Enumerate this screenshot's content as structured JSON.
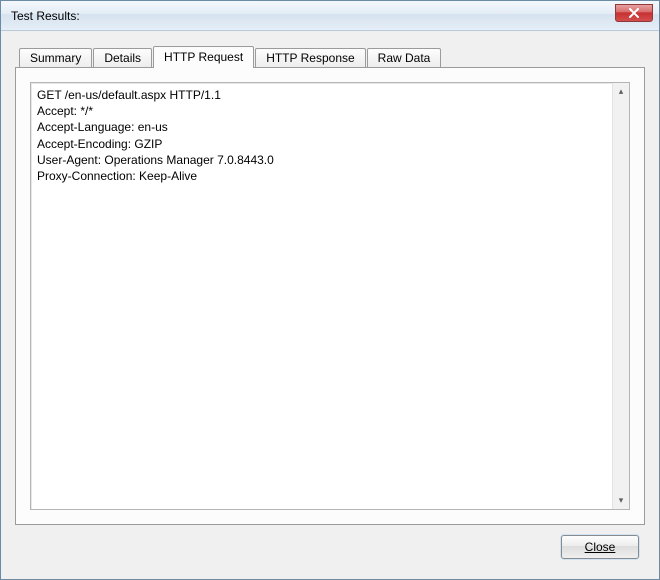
{
  "window": {
    "title": "Test Results:"
  },
  "tabs": [
    {
      "label": "Summary"
    },
    {
      "label": "Details"
    },
    {
      "label": "HTTP Request"
    },
    {
      "label": "HTTP Response"
    },
    {
      "label": "Raw Data"
    }
  ],
  "active_tab_index": 2,
  "content": "GET /en-us/default.aspx HTTP/1.1\nAccept: */*\nAccept-Language: en-us\nAccept-Encoding: GZIP\nUser-Agent: Operations Manager 7.0.8443.0\nProxy-Connection: Keep-Alive\n",
  "footer": {
    "close_label": "Close"
  }
}
